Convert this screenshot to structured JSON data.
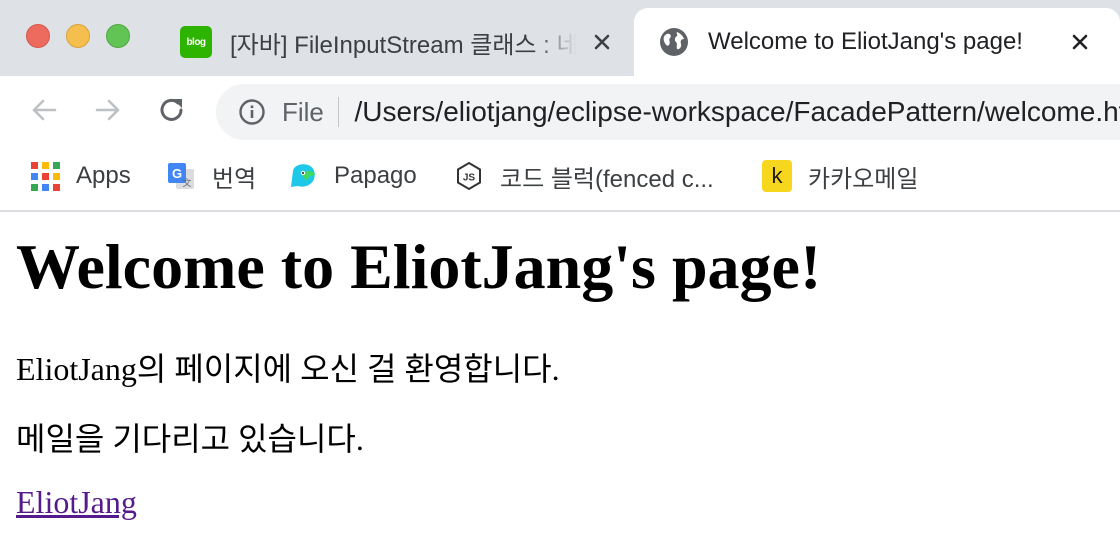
{
  "window": {
    "controls": [
      "close",
      "minimize",
      "zoom"
    ],
    "colors": {
      "close": "#ed6a5e",
      "minimize": "#f5bf4f",
      "zoom": "#61c454"
    }
  },
  "tabs": [
    {
      "title": "[자바] FileInputStream 클래스 : 네",
      "favicon": "naver-blog-icon",
      "favicon_text": "blog",
      "active": false
    },
    {
      "title": "Welcome to EliotJang's page!",
      "favicon": "globe-icon",
      "active": true
    }
  ],
  "toolbar": {
    "back_icon": "arrow-left-icon",
    "forward_icon": "arrow-right-icon",
    "reload_icon": "reload-icon",
    "omnibox": {
      "info_icon": "info-icon",
      "scheme_label": "File",
      "url": "/Users/eliotjang/eclipse-workspace/FacadePattern/welcome.html"
    }
  },
  "bookmarks": [
    {
      "label": "Apps",
      "icon": "apps-grid-icon"
    },
    {
      "label": "번역",
      "icon": "google-translate-icon"
    },
    {
      "label": "Papago",
      "icon": "papago-icon"
    },
    {
      "label": "코드 블럭(fenced c...",
      "icon": "nodejs-icon"
    },
    {
      "label": "카카오메일",
      "icon": "kakao-mail-icon",
      "icon_text": "k"
    }
  ],
  "page": {
    "heading": "Welcome to EliotJang's page!",
    "paragraph1": "EliotJang의 페이지에 오신 걸 환영합니다.",
    "paragraph2": "메일을 기다리고 있습니다.",
    "link_text": "EliotJang",
    "link_color": "#551a8b"
  }
}
